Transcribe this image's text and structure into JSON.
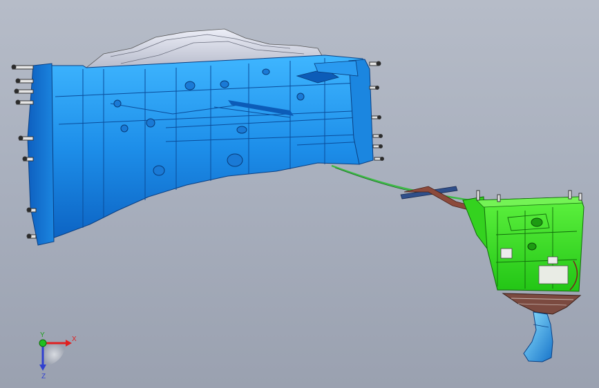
{
  "viewport": {
    "background_top": "#b6bcc8",
    "background_bottom": "#9aa1b0"
  },
  "model": {
    "transmission_color": "#1f8fe8",
    "shifter_color": "#2de21a",
    "cable_color": "#3dbb46",
    "bellhousing_cover_color": "#cfd3e2",
    "knob_color": "#2aa4e8"
  },
  "triad": {
    "x_label": "X",
    "y_label": "Y",
    "z_label": "Z",
    "x_color": "#e02020",
    "y_color": "#20c020",
    "z_color": "#3040d0"
  }
}
